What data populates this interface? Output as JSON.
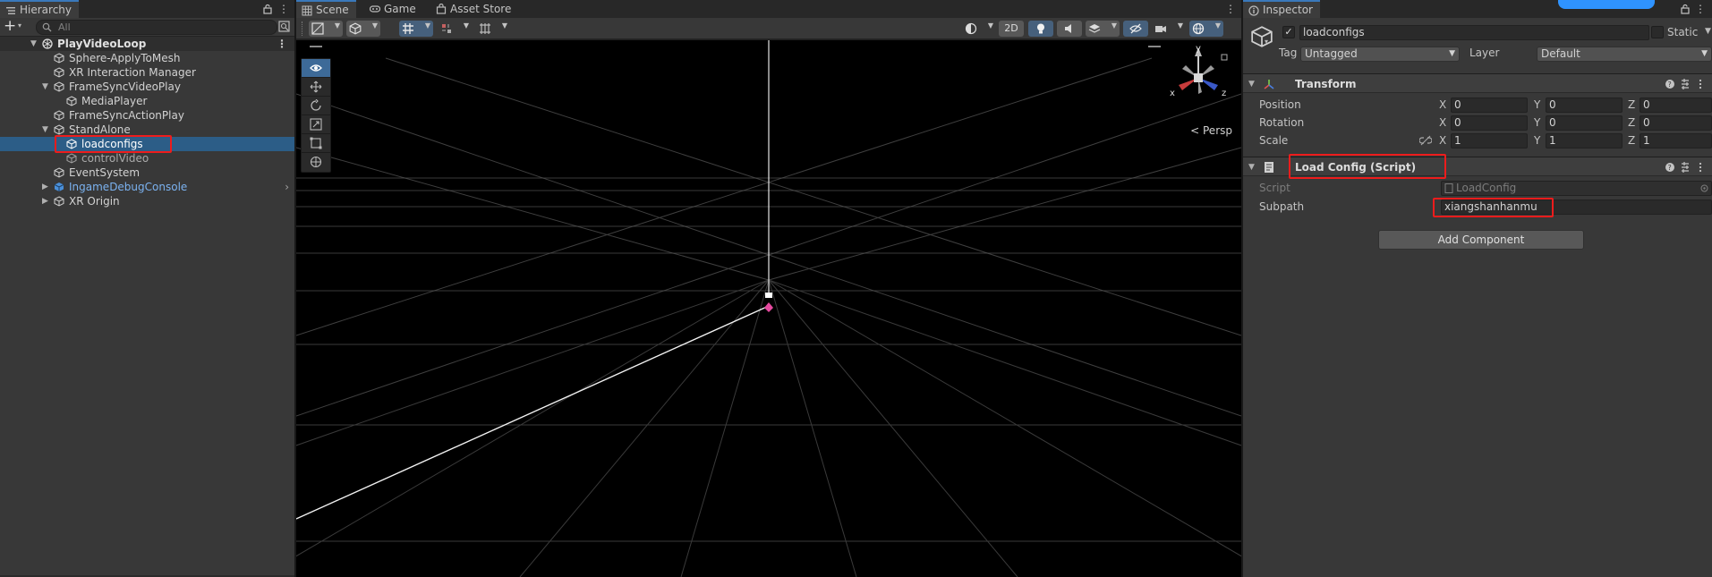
{
  "hierarchy": {
    "tab": "Hierarchy",
    "search_placeholder": "All",
    "add_label": "+",
    "scene_name": "PlayVideoLoop",
    "items": [
      {
        "label": "Sphere-ApplyToMesh"
      },
      {
        "label": "XR Interaction Manager"
      },
      {
        "label": "FrameSyncVideoPlay"
      },
      {
        "label": "MediaPlayer"
      },
      {
        "label": "FrameSyncActionPlay"
      },
      {
        "label": "StandAlone"
      },
      {
        "label": "loadconfigs"
      },
      {
        "label": "controlVideo"
      },
      {
        "label": "EventSystem"
      },
      {
        "label": "IngameDebugConsole"
      },
      {
        "label": "XR Origin"
      }
    ]
  },
  "scene": {
    "tabs": [
      "Scene",
      "Game",
      "Asset Store"
    ],
    "mode_2d": "2D",
    "persp_label": "Persp",
    "gizmo": {
      "x": "x",
      "y": "y",
      "z": "z"
    }
  },
  "inspector": {
    "tab": "Inspector",
    "object_name": "loadconfigs",
    "static_label": "Static",
    "tag_label": "Tag",
    "tag_value": "Untagged",
    "layer_label": "Layer",
    "layer_value": "Default",
    "transform": {
      "title": "Transform",
      "rows": [
        {
          "label": "Position",
          "x": "0",
          "y": "0",
          "z": "0"
        },
        {
          "label": "Rotation",
          "x": "0",
          "y": "0",
          "z": "0"
        },
        {
          "label": "Scale",
          "x": "1",
          "y": "1",
          "z": "1"
        }
      ]
    },
    "script_component": {
      "title": "Load Config (Script)",
      "script_label": "Script",
      "script_value": "LoadConfig",
      "subpath_label": "Subpath",
      "subpath_value": "xiangshanhanmu"
    },
    "add_component": "Add Component",
    "axis": {
      "x": "X",
      "y": "Y",
      "z": "Z"
    }
  },
  "colors": {
    "selection": "#2c5d87",
    "highlight_box": "#ee1c1c",
    "prefab_text": "#7bb2f0",
    "accent": "#3a79bb"
  }
}
